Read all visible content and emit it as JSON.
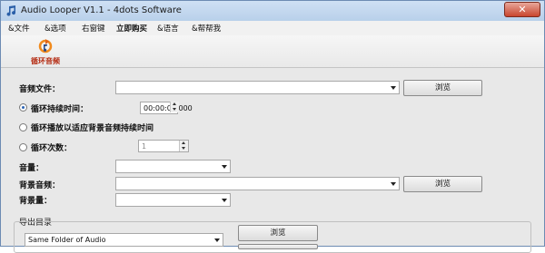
{
  "window": {
    "title": "Audio Looper V1.1 - 4dots Software",
    "close_glyph": "✕"
  },
  "menu": [
    "&文件",
    "&选项",
    "右窗键",
    "立即购买",
    "&语言",
    "&帮帮我"
  ],
  "toolbar": {
    "loop_audio": "循环音频"
  },
  "form": {
    "audio_file_label": "音频文件：",
    "audio_file_value": "",
    "browse": "浏览",
    "loop_duration_label": "循环持续时间：",
    "loop_duration_value": "00:00:00.000",
    "loop_to_bg_label": "循环播放以适应背景音频持续时间",
    "loop_count_label": "循环次数：",
    "loop_count_value": "1",
    "volume_label": "音量：",
    "volume_value": "",
    "bg_audio_label": "背景音频：",
    "bg_audio_value": "",
    "bg_volume_label": "背景量：",
    "bg_volume_value": ""
  },
  "output": {
    "section_label": "导出目录",
    "folder_value": "Same Folder of Audio",
    "browse": "浏览"
  },
  "colors": {
    "accent_red": "#b42b12",
    "title_bg": "#cfe0f4"
  }
}
